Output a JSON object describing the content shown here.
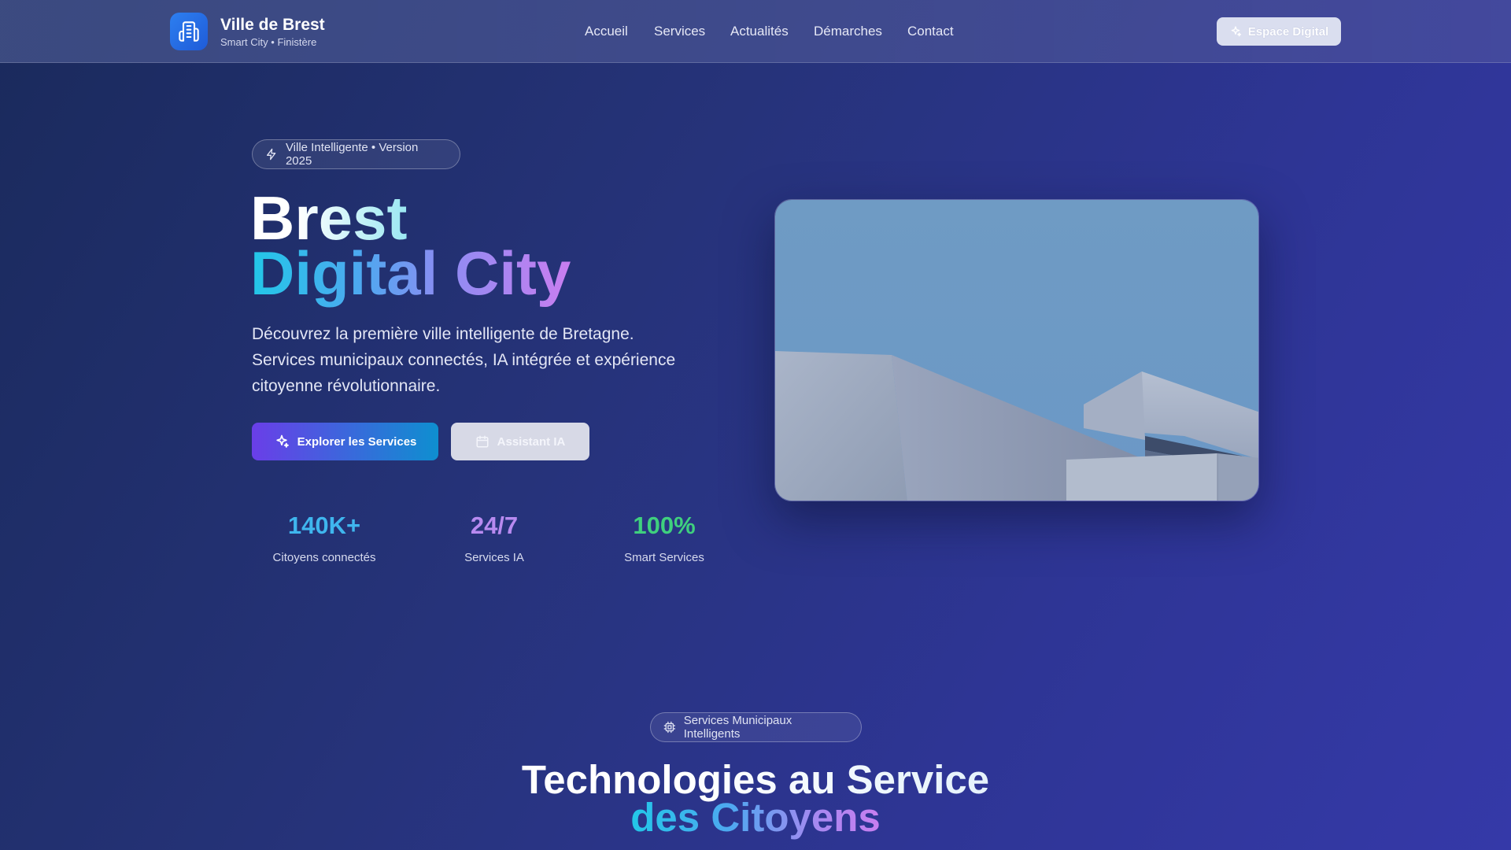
{
  "header": {
    "brand_title": "Ville de Brest",
    "brand_subtitle": "Smart City • Finistère",
    "logo_icon": "building-icon",
    "nav": [
      "Accueil",
      "Services",
      "Actualités",
      "Démarches",
      "Contact"
    ],
    "cta_label": "Espace Digital",
    "cta_icon": "sparkles-icon"
  },
  "hero": {
    "badge": "Ville Intelligente • Version 2025",
    "badge_icon": "lightning-icon",
    "title_line1": "Brest",
    "title_line2": "Digital City",
    "description": "Découvrez la première ville intelligente de Bretagne. Services municipaux connectés, IA intégrée et expérience citoyenne révolutionnaire.",
    "primary_button": "Explorer les Services",
    "primary_icon": "sparkles-icon",
    "secondary_button": "Assistant IA",
    "secondary_icon": "calendar-icon",
    "stats": [
      {
        "value": "140K+",
        "label": "Citoyens connectés",
        "color": "#3fb6ee"
      },
      {
        "value": "24/7",
        "label": "Services IA",
        "color": "#b88af0"
      },
      {
        "value": "100%",
        "label": "Smart Services",
        "color": "#3fd07e"
      }
    ],
    "image_icon": "concrete-architecture-photo"
  },
  "services_section": {
    "badge": "Services Municipaux Intelligents",
    "badge_icon": "chip-icon",
    "title_line1": "Technologies au Service",
    "title_line2": "des Citoyens"
  },
  "colors": {
    "accent_purple": "#6a3ee8",
    "accent_cyan": "#22c7e8",
    "accent_green": "#3fd07e"
  }
}
